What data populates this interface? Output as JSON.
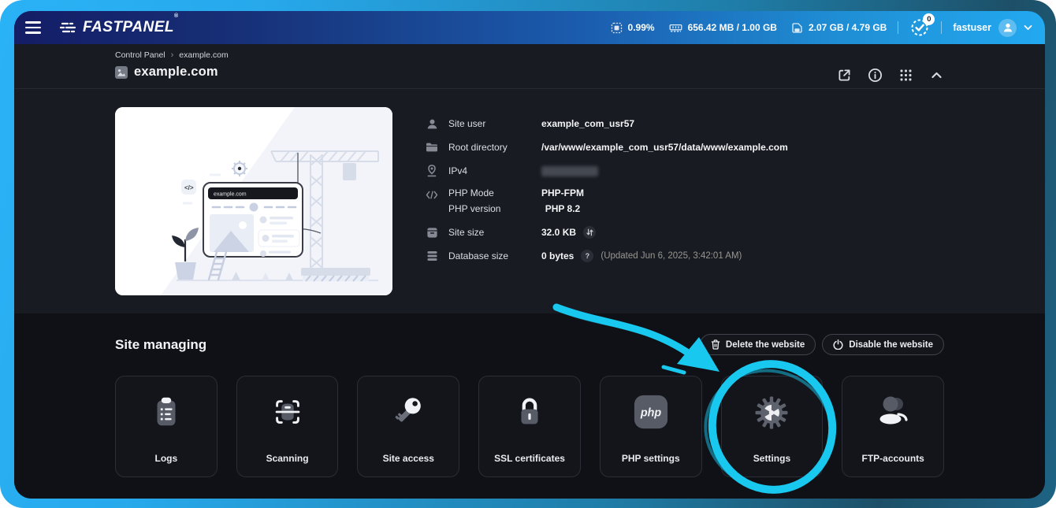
{
  "colors": {
    "highlight": "#19c8ee",
    "topbar_gradient_start": "#141d66",
    "topbar_gradient_end": "#22a9f0",
    "frame_gradient_start": "#2ab2f6",
    "frame_gradient_end": "#1e6384",
    "app_background": "#15171e",
    "section_upper": "#191b23",
    "section_lower": "#0f1117"
  },
  "topbar": {
    "brand": "FASTPANEL",
    "brand_reg": "®",
    "cpu": "0.99%",
    "ram": "656.42 MB / 1.00 GB",
    "disk": "2.07 GB / 4.79 GB",
    "tasks_badge": "0",
    "username": "fastuser"
  },
  "header": {
    "breadcrumb": [
      "Control Panel",
      "example.com"
    ],
    "breadcrumb_sep": "›",
    "title": "example.com"
  },
  "site_info": {
    "illustration_domain": "example.com",
    "site_user_label": "Site user",
    "site_user_value": "example_com_usr57",
    "root_dir_label": "Root directory",
    "root_dir_value": "/var/www/example_com_usr57/data/www/example.com",
    "ipv4_label": "IPv4",
    "php_mode_label": "PHP Mode",
    "php_mode_value": "PHP-FPM",
    "php_version_label": "PHP version",
    "php_version_value": "PHP 8.2",
    "site_size_label": "Site size",
    "site_size_value": "32.0 KB",
    "db_size_label": "Database size",
    "db_size_value": "0 bytes",
    "db_help": "?",
    "db_size_note": "(Updated Jun 6, 2025, 3:42:01 AM)"
  },
  "site_managing": {
    "title": "Site managing",
    "delete_button": "Delete the website",
    "disable_button": "Disable the website",
    "php_badge": "php",
    "cards": [
      {
        "icon": "logs-icon",
        "label": "Logs"
      },
      {
        "icon": "scanning-icon",
        "label": "Scanning"
      },
      {
        "icon": "key-icon",
        "label": "Site access"
      },
      {
        "icon": "ssl-lock-icon",
        "label": "SSL certificates"
      },
      {
        "icon": "php-icon",
        "label": "PHP settings"
      },
      {
        "icon": "settings-gear-icon",
        "label": "Settings"
      },
      {
        "icon": "ftp-users-icon",
        "label": "FTP-accounts"
      }
    ]
  }
}
